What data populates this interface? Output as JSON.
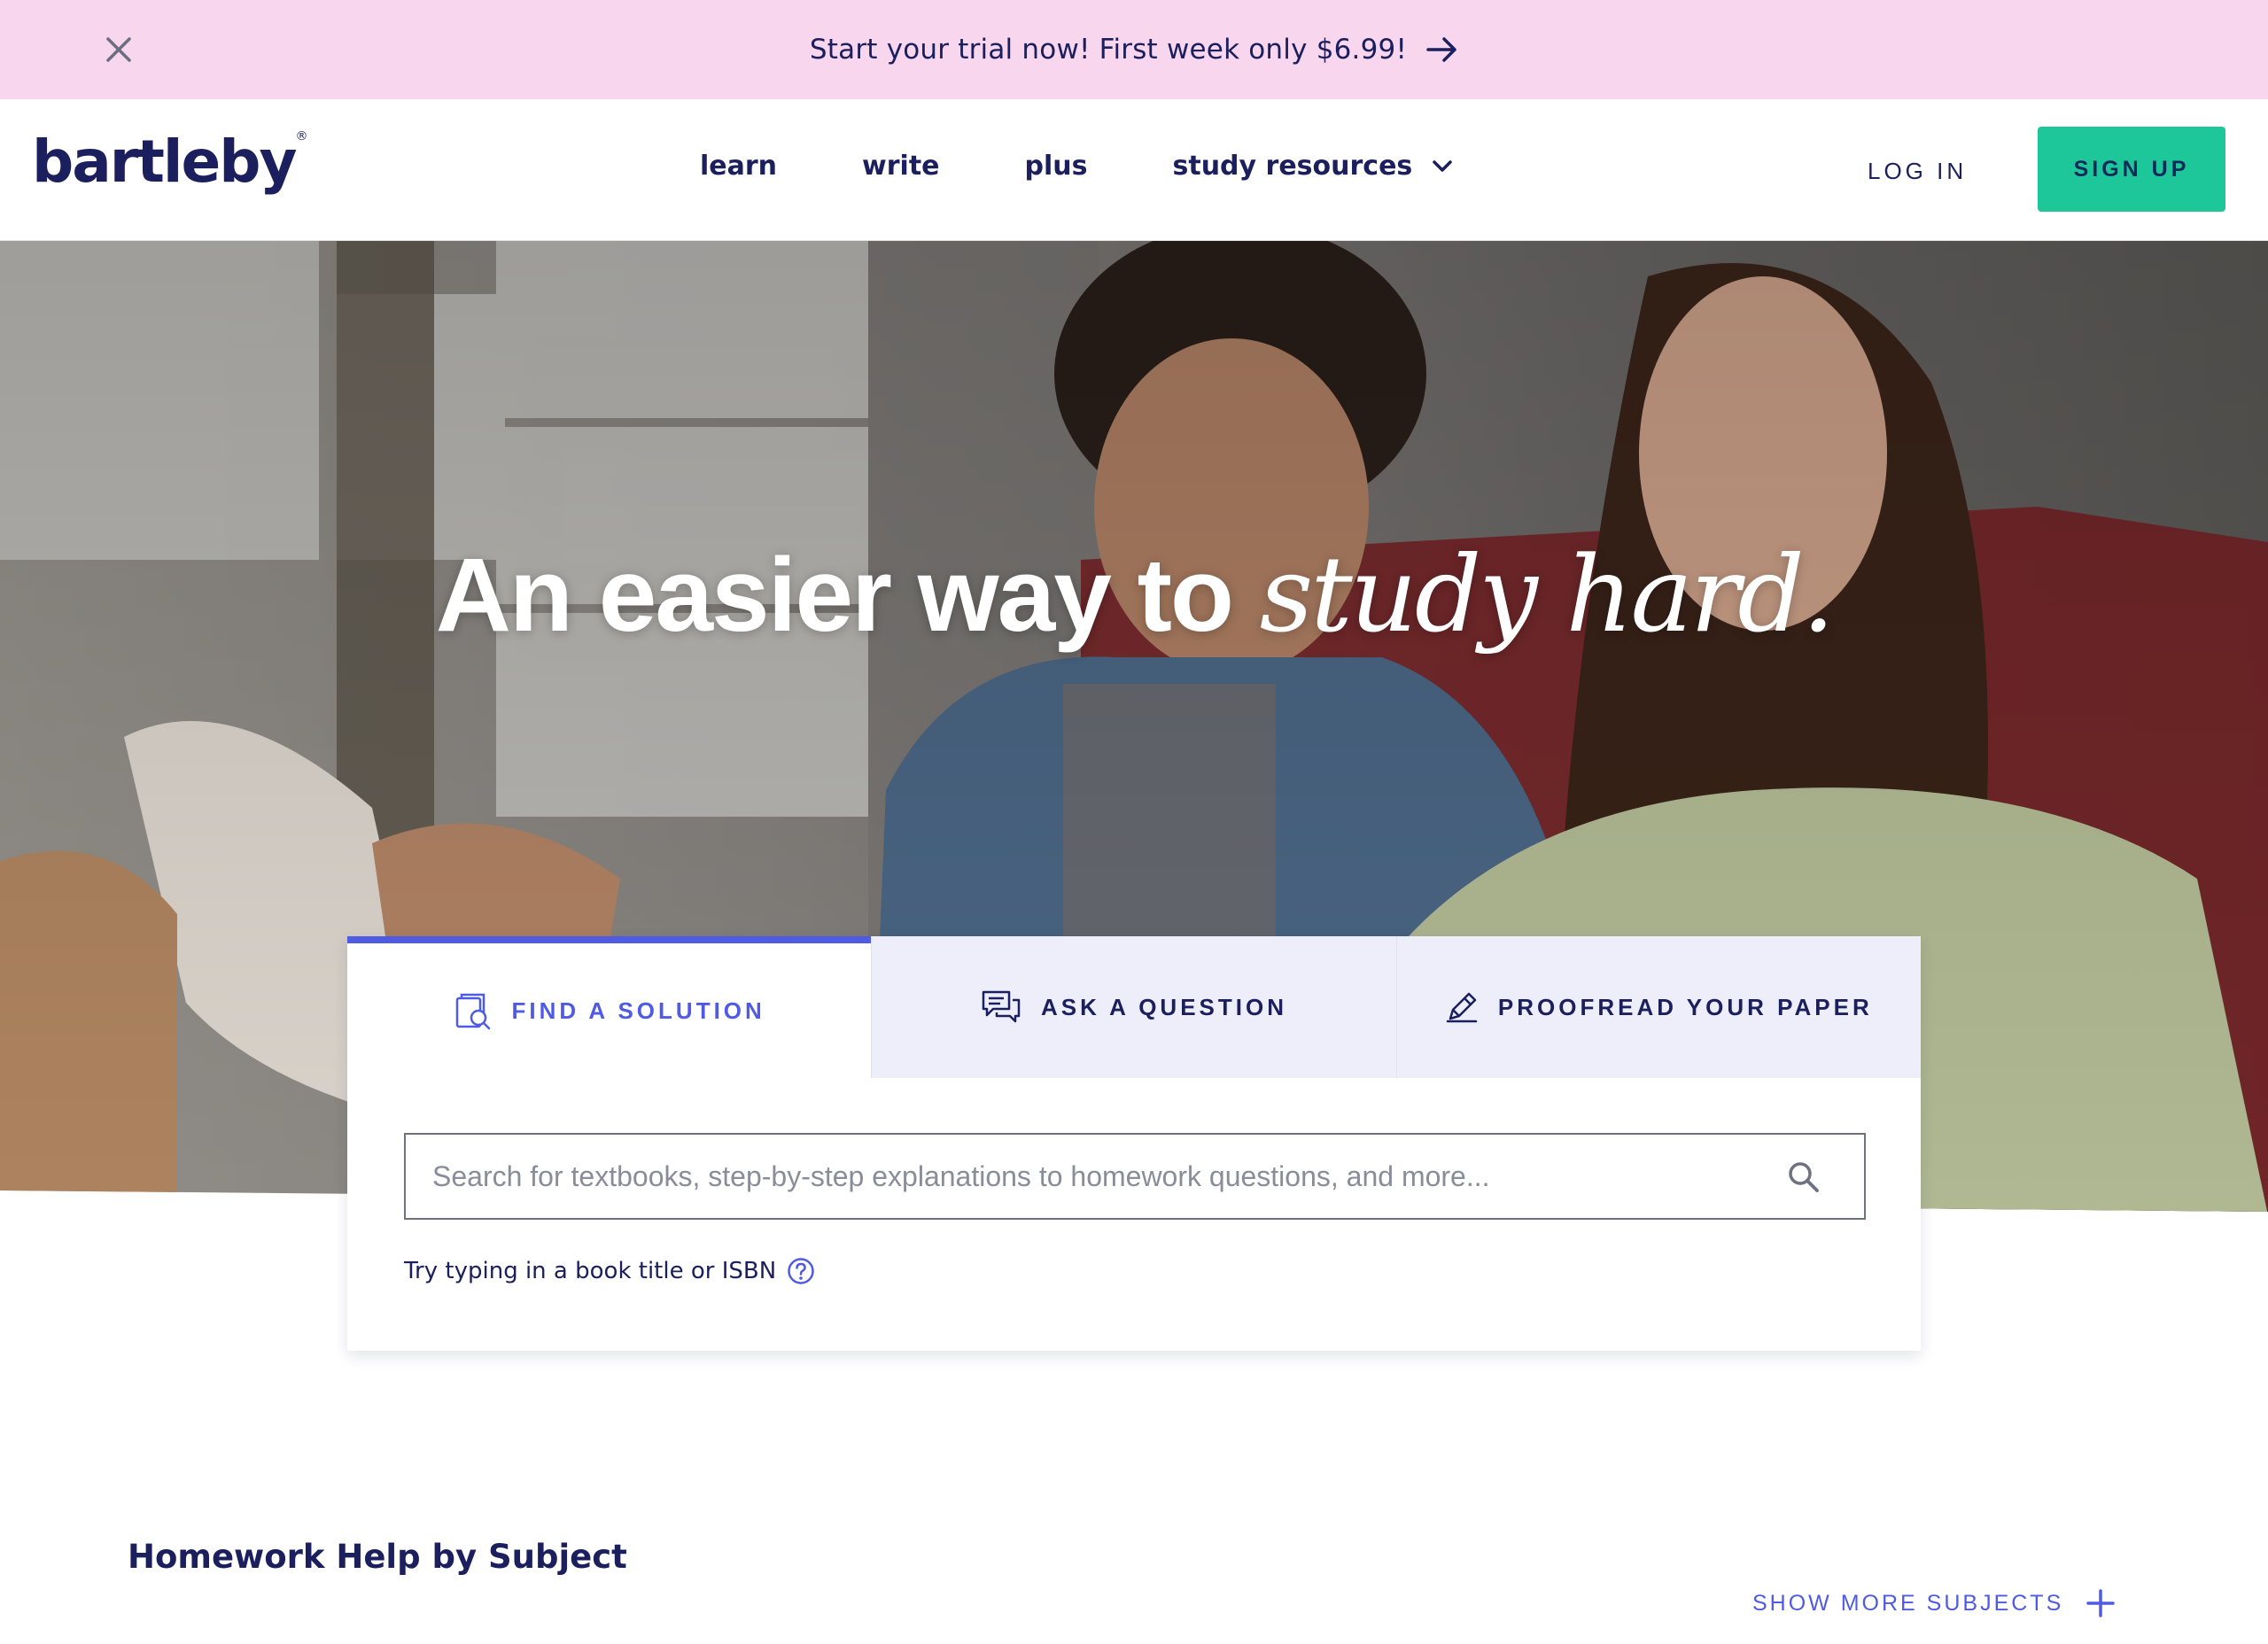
{
  "promo": {
    "text": "Start your trial now! First week only $6.99!",
    "close_icon": "close-icon",
    "arrow_icon": "arrow-right-icon"
  },
  "header": {
    "logo": "bartleby",
    "logo_mark": "®",
    "nav": [
      {
        "label": "learn"
      },
      {
        "label": "write"
      },
      {
        "label": "plus"
      },
      {
        "label": "study resources",
        "icon": "chevron-down-icon"
      }
    ],
    "login": "LOG IN",
    "signup": "SIGN UP"
  },
  "hero": {
    "title_plain": "An easier way to ",
    "title_accent": "study hard."
  },
  "search_card": {
    "tabs": [
      {
        "label": "FIND A SOLUTION",
        "icon": "book-search-icon",
        "active": true
      },
      {
        "label": "ASK A QUESTION",
        "icon": "chat-bubbles-icon",
        "active": false
      },
      {
        "label": "PROOFREAD YOUR PAPER",
        "icon": "pencil-icon",
        "active": false
      }
    ],
    "search_placeholder": "Search for textbooks, step-by-step explanations to homework questions, and more...",
    "hint": "Try typing in a book title or ISBN"
  },
  "subjects": {
    "title": "Homework Help by Subject",
    "show_more": "SHOW MORE SUBJECTS"
  },
  "colors": {
    "banner": "#f7d6ee",
    "brand_navy": "#1b1f5e",
    "accent_purple": "#4f5be3",
    "signup_green": "#1ec79a",
    "tab_inactive": "#eeeefb"
  }
}
